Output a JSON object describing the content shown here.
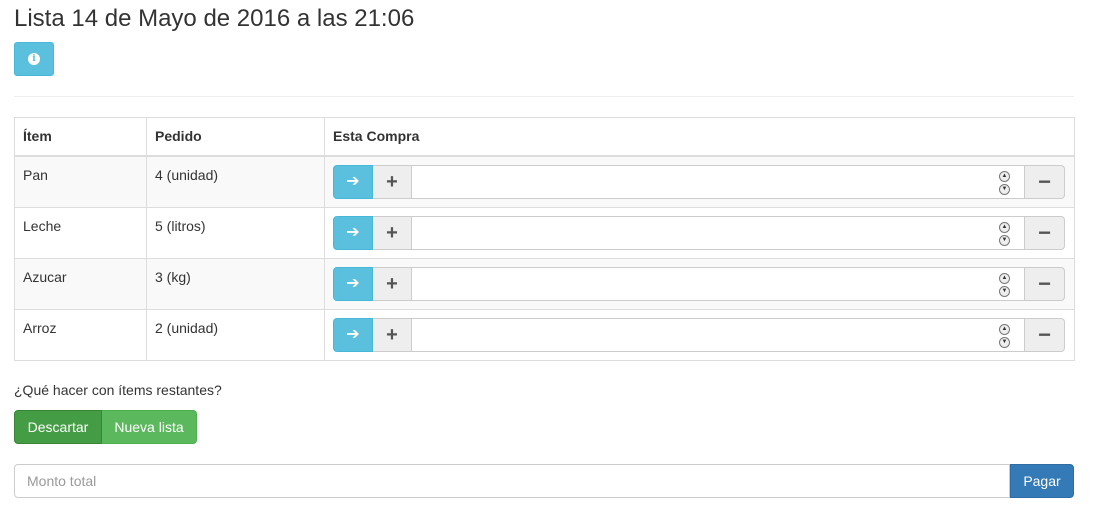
{
  "title": "Lista 14 de Mayo de 2016 a las 21:06",
  "info_button": {
    "icon": "info-circle-icon",
    "color": "#5bc0de"
  },
  "table": {
    "headers": [
      "Ítem",
      "Pedido",
      "Esta Compra"
    ],
    "rows": [
      {
        "item": "Pan",
        "ordered": "4 (unidad)"
      },
      {
        "item": "Leche",
        "ordered": "5 (litros)"
      },
      {
        "item": "Azucar",
        "ordered": "3 (kg)"
      },
      {
        "item": "Arroz",
        "ordered": "2 (unidad)"
      }
    ],
    "row_controls": {
      "fill_icon": "arrow-right-icon",
      "increment_icon": "plus-icon",
      "decrement_icon": "minus-icon"
    }
  },
  "remaining": {
    "question": "¿Qué hacer con ítems restantes?",
    "discard_label": "Descartar",
    "new_list_label": "Nueva lista"
  },
  "total": {
    "placeholder": "Monto total",
    "pay_label": "Pagar"
  },
  "colors": {
    "info": "#5bc0de",
    "success": "#5cb85c",
    "success_active": "#449d44",
    "primary": "#337ab7"
  }
}
